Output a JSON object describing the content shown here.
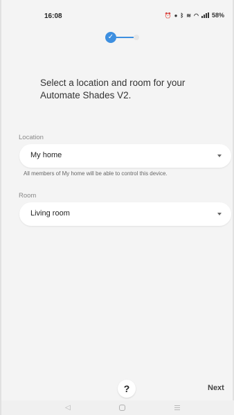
{
  "status_bar": {
    "time": "16:08",
    "icons": [
      "alarm-icon",
      "record-icon",
      "bluetooth-icon",
      "volte-icon",
      "wifi-icon",
      "signal-icon"
    ],
    "battery": "58%"
  },
  "progress": {
    "current_step": 1,
    "total_steps": 2
  },
  "headline": "Select a location and room for your Automate Shades V2.",
  "location": {
    "label": "Location",
    "value": "My home",
    "helper": "All members of My home will be able to control this device."
  },
  "room": {
    "label": "Room",
    "value": "Living room"
  },
  "footer": {
    "help_label": "?",
    "next_label": "Next"
  },
  "colors": {
    "accent": "#3d8fe0",
    "background": "#f4f4f4",
    "card": "#ffffff"
  }
}
